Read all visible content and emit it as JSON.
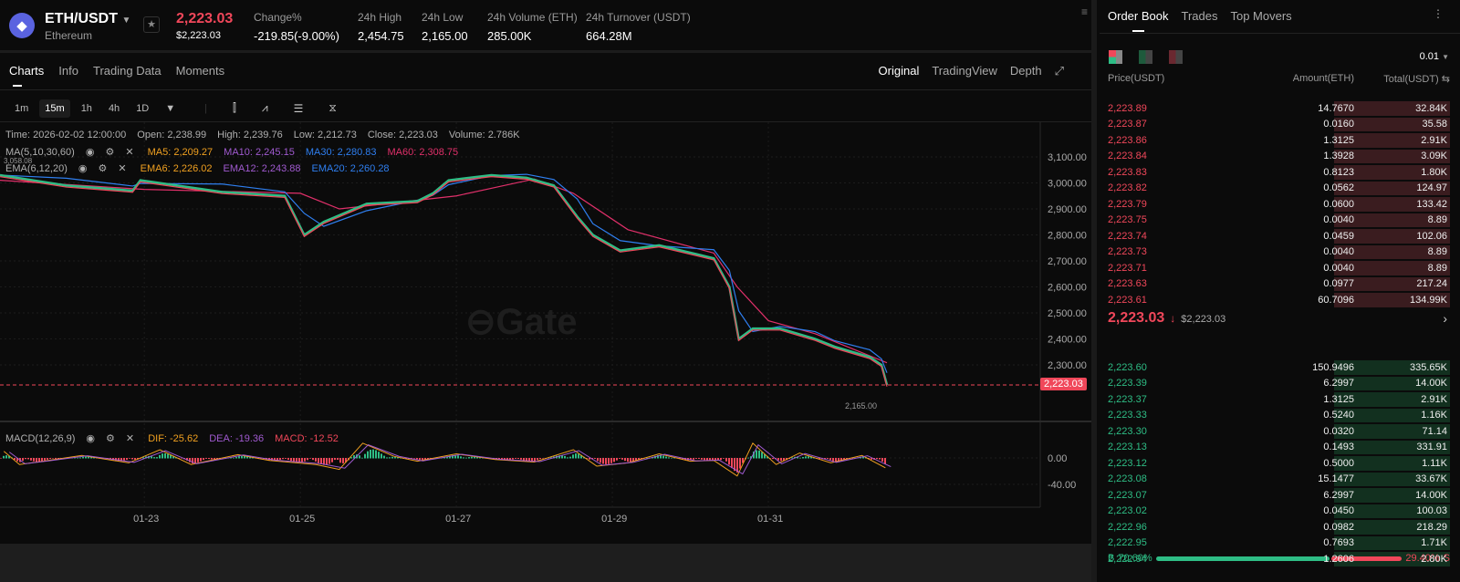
{
  "header": {
    "pair": "ETH/USDT",
    "name": "Ethereum",
    "price": "2,223.03",
    "price_usd": "$2,223.03",
    "stats": [
      {
        "label": "Change%",
        "value": "-219.85(-9.00%)",
        "color": "red"
      },
      {
        "label": "24h High",
        "value": "2,454.75"
      },
      {
        "label": "24h Low",
        "value": "2,165.00"
      },
      {
        "label": "24h Volume (ETH)",
        "value": "285.00K"
      },
      {
        "label": "24h Turnover (USDT)",
        "value": "664.28M"
      }
    ]
  },
  "tabs": [
    "Charts",
    "Info",
    "Trading Data",
    "Moments"
  ],
  "view_tabs": [
    "Original",
    "TradingView",
    "Depth"
  ],
  "timeframes": [
    "1m",
    "15m",
    "1h",
    "4h",
    "1D"
  ],
  "ohlc": {
    "time": "Time: 2026-02-02 12:00:00",
    "open": "Open: 2,238.99",
    "high": "High: 2,239.76",
    "low": "Low: 2,212.73",
    "close": "Close: 2,223.03",
    "volume": "Volume: 2.786K"
  },
  "ma": {
    "label": "MA(5,10,30,60)",
    "ma5": "MA5: 2,209.27",
    "ma10": "MA10: 2,245.15",
    "ma30": "MA30: 2,280.83",
    "ma60": "MA60: 2,308.75"
  },
  "ema": {
    "label": "EMA(6,12,20)",
    "ema6": "EMA6: 2,226.02",
    "ema12": "EMA12: 2,243.88",
    "ema20": "EMA20: 2,260.28"
  },
  "macd": {
    "label": "MACD(12,26,9)",
    "dif": "DIF: -25.62",
    "dea": "DEA: -19.36",
    "macd": "MACD: -12.52"
  },
  "colors": {
    "up": "#2ebd85",
    "down": "#f0475a",
    "ma5": "#f0a020",
    "ma10": "#a05ad0",
    "ma30": "#2f7ff0",
    "ma60": "#e0306a"
  },
  "chart_data": {
    "type": "line",
    "title": "ETH/USDT 15m",
    "price_axis": {
      "ticks": [
        "3,100.00",
        "3,000.00",
        "2,900.00",
        "2,800.00",
        "2,700.00",
        "2,600.00",
        "2,500.00",
        "2,400.00",
        "2,300.00"
      ],
      "ylim": [
        2180,
        3160
      ]
    },
    "high_marker": "3,058.08",
    "low_marker": "2,165.00",
    "last_price": "2,223.03",
    "x_ticks": [
      "01-23",
      "01-25",
      "01-27",
      "01-29",
      "01-31"
    ],
    "x_day_range": [
      -0.85,
      10.52
    ],
    "price_series": {
      "day": [
        -0.85,
        0,
        0.85,
        0.95,
        2,
        2.8,
        3.05,
        3.3,
        3.85,
        4.5,
        4.7,
        4.9,
        5.45,
        5.9,
        6.25,
        6.55,
        6.75,
        7.1,
        7.6,
        8.3,
        8.5,
        8.62,
        8.8,
        9.15,
        9.6,
        9.85,
        10.3,
        10.45,
        10.52
      ],
      "price": [
        3030,
        2990,
        2970,
        3010,
        2965,
        2950,
        2800,
        2850,
        2920,
        2930,
        2960,
        3010,
        3030,
        3020,
        2990,
        2870,
        2800,
        2740,
        2760,
        2710,
        2600,
        2400,
        2440,
        2440,
        2400,
        2370,
        2330,
        2300,
        2223
      ]
    },
    "ma60_series": {
      "day": [
        -0.85,
        1,
        3,
        3.5,
        5,
        6,
        6.5,
        7.2,
        8.3,
        8.6,
        9,
        9.6,
        10.52
      ],
      "price": [
        3010,
        2975,
        2960,
        2900,
        2950,
        3015,
        2960,
        2820,
        2730,
        2600,
        2470,
        2420,
        2308
      ]
    },
    "macd_axis": {
      "ticks": [
        "0.00",
        "-40.00"
      ]
    },
    "macd_hist": {
      "day": [
        -0.8,
        -0.6,
        -0.3,
        0.2,
        0.8,
        1.2,
        1.6,
        2.2,
        2.6,
        3.2,
        3.5,
        3.8,
        4.2,
        4.5,
        5,
        5.5,
        6,
        6.5,
        6.8,
        7.2,
        7.6,
        8,
        8.3,
        8.6,
        8.8,
        9.1,
        9.4,
        9.8,
        10.2,
        10.5
      ],
      "value": [
        8,
        -8,
        -4,
        3,
        -6,
        10,
        -8,
        4,
        -3,
        -8,
        -14,
        18,
        2,
        -4,
        5,
        -2,
        -5,
        10,
        -10,
        -6,
        5,
        -4,
        -3,
        -22,
        18,
        -8,
        6,
        -6,
        3,
        -12
      ]
    }
  },
  "orderbook": {
    "tabs": [
      "Order Book",
      "Trades",
      "Top Movers"
    ],
    "precision": "0.01",
    "headers": [
      "Price(USDT)",
      "Amount(ETH)",
      "Total(USDT)"
    ],
    "asks": [
      [
        "2,223.89",
        "14.7670",
        "32.84K"
      ],
      [
        "2,223.87",
        "0.0160",
        "35.58"
      ],
      [
        "2,223.86",
        "1.3125",
        "2.91K"
      ],
      [
        "2,223.84",
        "1.3928",
        "3.09K"
      ],
      [
        "2,223.83",
        "0.8123",
        "1.80K"
      ],
      [
        "2,223.82",
        "0.0562",
        "124.97"
      ],
      [
        "2,223.79",
        "0.0600",
        "133.42"
      ],
      [
        "2,223.75",
        "0.0040",
        "8.89"
      ],
      [
        "2,223.74",
        "0.0459",
        "102.06"
      ],
      [
        "2,223.73",
        "0.0040",
        "8.89"
      ],
      [
        "2,223.71",
        "0.0040",
        "8.89"
      ],
      [
        "2,223.63",
        "0.0977",
        "217.24"
      ],
      [
        "2,223.61",
        "60.7096",
        "134.99K"
      ]
    ],
    "mid": {
      "price": "2,223.03",
      "usd": "$2,223.03"
    },
    "bids": [
      [
        "2,223.60",
        "150.9496",
        "335.65K"
      ],
      [
        "2,223.39",
        "6.2997",
        "14.00K"
      ],
      [
        "2,223.37",
        "1.3125",
        "2.91K"
      ],
      [
        "2,223.33",
        "0.5240",
        "1.16K"
      ],
      [
        "2,223.30",
        "0.0320",
        "71.14"
      ],
      [
        "2,223.13",
        "0.1493",
        "331.91"
      ],
      [
        "2,223.12",
        "0.5000",
        "1.11K"
      ],
      [
        "2,223.08",
        "15.1477",
        "33.67K"
      ],
      [
        "2,223.07",
        "6.2997",
        "14.00K"
      ],
      [
        "2,223.02",
        "0.0450",
        "100.03"
      ],
      [
        "2,222.96",
        "0.0982",
        "218.29"
      ],
      [
        "2,222.95",
        "0.7693",
        "1.71K"
      ],
      [
        "2,222.94",
        "1.2606",
        "2.80K"
      ]
    ],
    "ratio": {
      "buy_label": "B",
      "buy": "70.60%",
      "sell": "29.40%",
      "sell_label": "S",
      "buy_fraction": 0.706
    }
  }
}
